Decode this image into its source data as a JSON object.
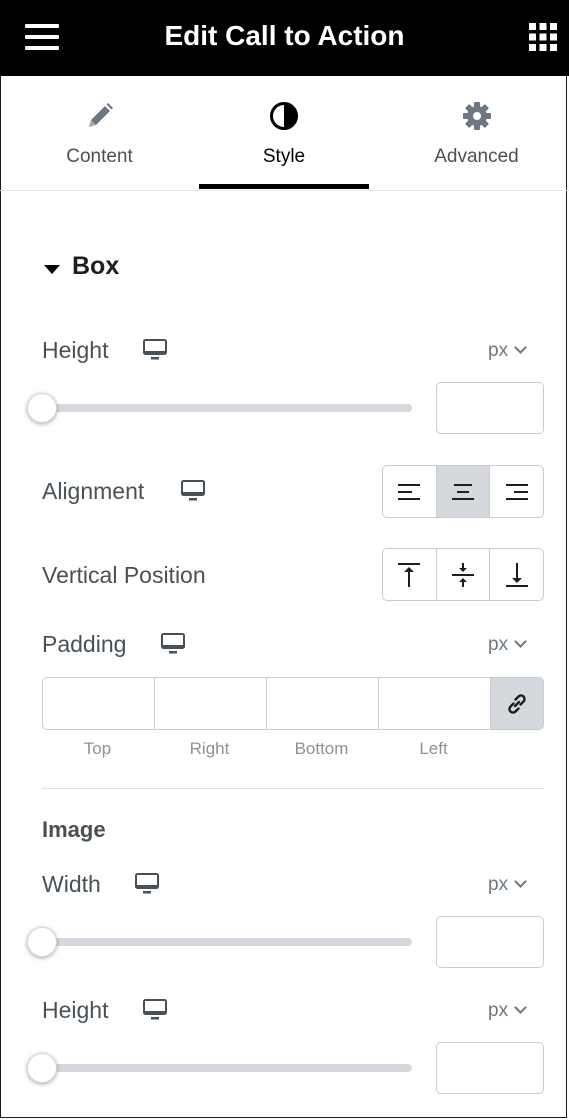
{
  "header": {
    "title": "Edit Call to Action",
    "menu_icon": "hamburger-icon",
    "apps_icon": "grid-icon"
  },
  "tabs": [
    {
      "label": "Content",
      "icon": "pencil-icon"
    },
    {
      "label": "Style",
      "icon": "half-circle-icon",
      "active": true
    },
    {
      "label": "Advanced",
      "icon": "gear-icon"
    }
  ],
  "box_section": {
    "title": "Box",
    "height": {
      "label": "Height",
      "unit": "px",
      "value": ""
    },
    "alignment": {
      "label": "Alignment",
      "options": [
        "left",
        "center",
        "right"
      ],
      "selected": "center"
    },
    "vertical_position": {
      "label": "Vertical Position",
      "options": [
        "top",
        "middle",
        "bottom"
      ]
    },
    "padding": {
      "label": "Padding",
      "unit": "px",
      "fields": [
        "Top",
        "Right",
        "Bottom",
        "Left"
      ],
      "values": [
        "",
        "",
        "",
        ""
      ]
    }
  },
  "image_section": {
    "title": "Image",
    "width": {
      "label": "Width",
      "unit": "px",
      "value": ""
    },
    "height": {
      "label": "Height",
      "unit": "px",
      "value": ""
    }
  },
  "colors": {
    "header_bg": "#000000",
    "accent": "#000000",
    "label": "#495157",
    "border": "#c9cdd1",
    "active_bg": "#d5d8dc"
  }
}
